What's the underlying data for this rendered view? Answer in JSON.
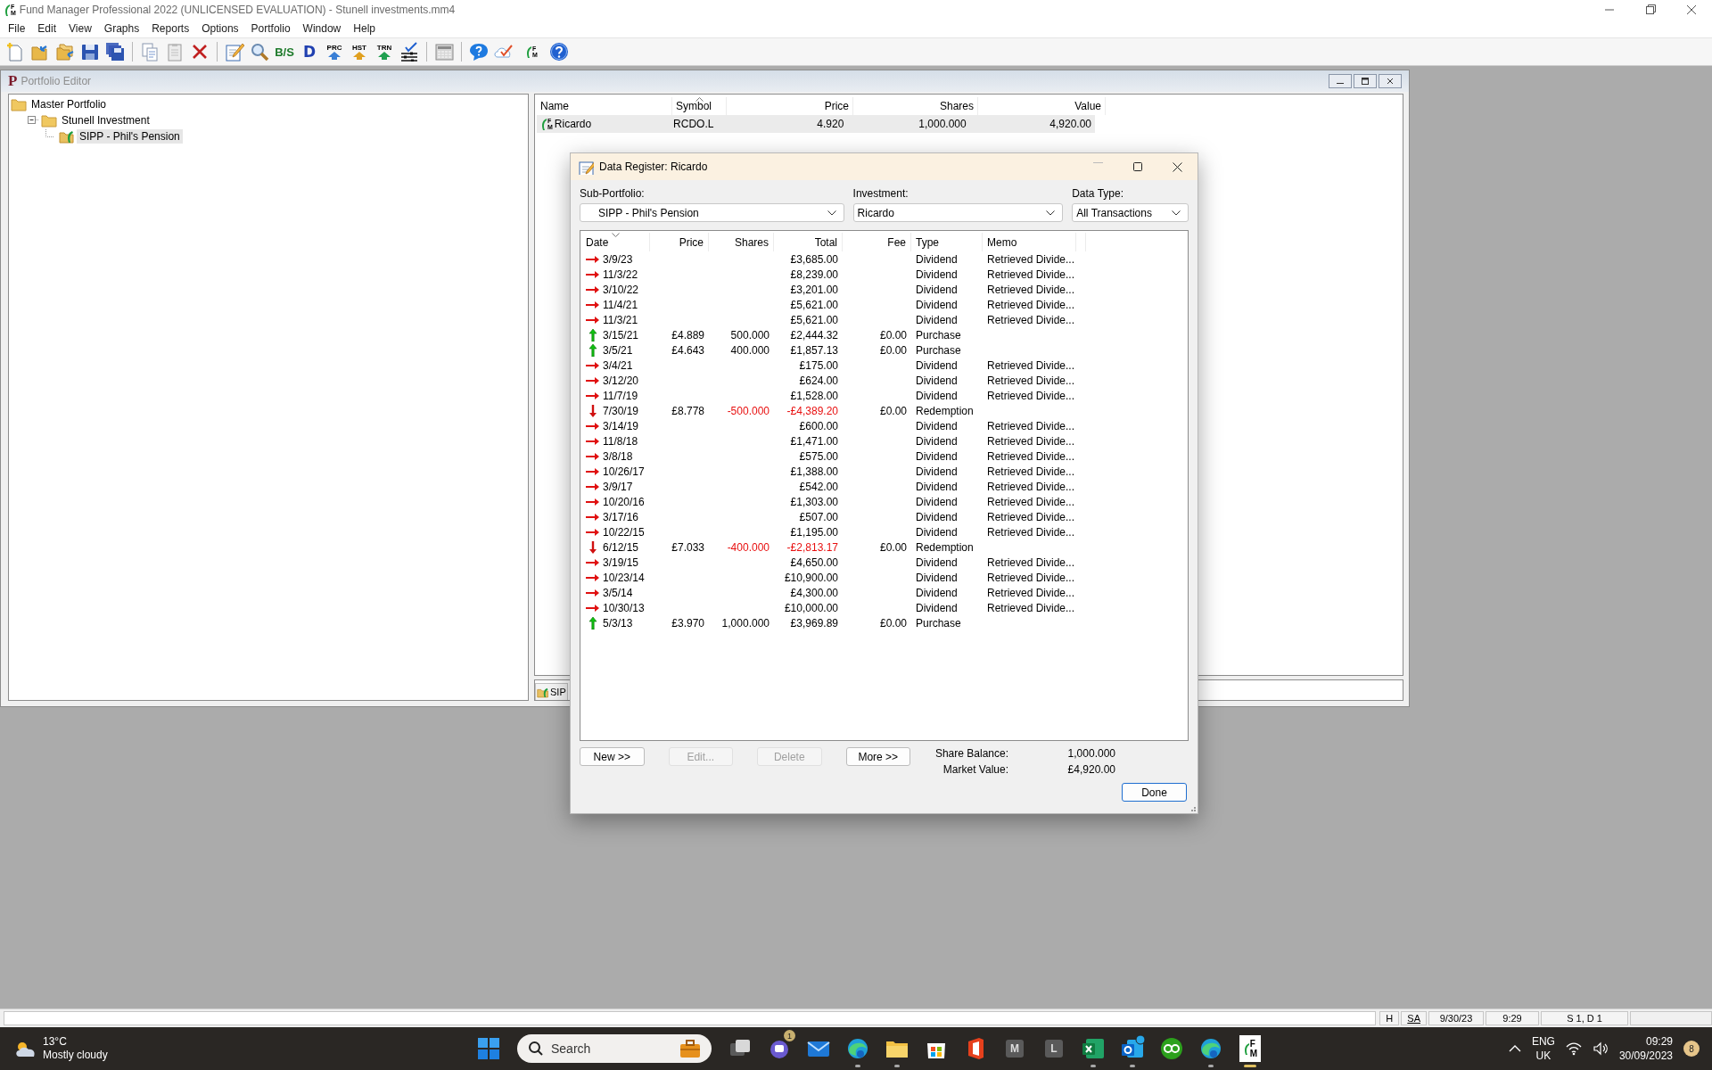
{
  "window": {
    "title": "Fund Manager Professional 2022 (UNLICENSED EVALUATION) - Stunell investments.mm4",
    "icon_letters": [
      "F",
      "M"
    ]
  },
  "menu": [
    "File",
    "Edit",
    "View",
    "Graphs",
    "Reports",
    "Options",
    "Portfolio",
    "Window",
    "Help"
  ],
  "toolbar": [
    {
      "kind": "new"
    },
    {
      "kind": "open"
    },
    {
      "kind": "open-copy"
    },
    {
      "kind": "save"
    },
    {
      "kind": "save-all"
    },
    {
      "kind": "sep"
    },
    {
      "kind": "copy"
    },
    {
      "kind": "paste"
    },
    {
      "kind": "delete"
    },
    {
      "kind": "sep"
    },
    {
      "kind": "edit"
    },
    {
      "kind": "find"
    },
    {
      "kind": "bs",
      "label": "B/S"
    },
    {
      "kind": "d",
      "label": "D"
    },
    {
      "kind": "arrow",
      "label": "PRC",
      "color": "#3a7fd5"
    },
    {
      "kind": "arrow",
      "label": "HST",
      "color": "#e0a020"
    },
    {
      "kind": "arrow",
      "label": "TRN",
      "color": "#20a050"
    },
    {
      "kind": "filter"
    },
    {
      "kind": "sep"
    },
    {
      "kind": "calc"
    },
    {
      "kind": "sep"
    },
    {
      "kind": "chat"
    },
    {
      "kind": "cloud"
    },
    {
      "kind": "fm",
      "letters": [
        "F",
        "M"
      ]
    },
    {
      "kind": "help"
    }
  ],
  "portfolio_editor": {
    "title": "Portfolio Editor",
    "icon_letter": "P",
    "tree": [
      {
        "label": "Master Portfolio",
        "kind": "folder",
        "selected": false,
        "children": [
          {
            "label": "Stunell Investment",
            "kind": "folder",
            "selected": false,
            "expanded": true,
            "children": [
              {
                "label": "SIPP - Phil's Pension",
                "kind": "subportfolio",
                "selected": true
              }
            ]
          }
        ]
      }
    ],
    "columns": [
      {
        "label": "Name",
        "sorted": false
      },
      {
        "label": "Symbol",
        "sorted": true,
        "sort_descending": false
      },
      {
        "label": "Price",
        "sorted": false
      },
      {
        "label": "Shares",
        "sorted": false
      },
      {
        "label": "Value",
        "sorted": false
      }
    ],
    "rows": [
      {
        "icon_letters": [
          "F",
          "M"
        ],
        "cells": [
          "Ricardo",
          "RCDO.L",
          "4.920",
          "1,000.000",
          "4,920.00"
        ],
        "selected": true
      }
    ],
    "tab": {
      "label": "SIP"
    }
  },
  "dialog": {
    "title": "Data Register: Ricardo",
    "filters": [
      {
        "label": "Sub-Portfolio:",
        "value": "SIPP - Phil's Pension"
      },
      {
        "label": "Investment:",
        "value": "Ricardo"
      },
      {
        "label": "Data Type:",
        "value": "All Transactions"
      }
    ],
    "columns": [
      {
        "label": "Date",
        "sorted": true,
        "sort_descending": true
      },
      {
        "label": "Price",
        "sorted": false
      },
      {
        "label": "Shares",
        "sorted": false
      },
      {
        "label": "Total",
        "sorted": false
      },
      {
        "label": "Fee",
        "sorted": false
      },
      {
        "label": "Type",
        "sorted": false
      },
      {
        "label": "Memo",
        "sorted": false
      }
    ],
    "rows": [
      {
        "kind": "dividend",
        "date": "3/9/23",
        "total": "£3,685.00",
        "type": "Dividend",
        "memo": "Retrieved Divide..."
      },
      {
        "kind": "dividend",
        "date": "11/3/22",
        "total": "£8,239.00",
        "type": "Dividend",
        "memo": "Retrieved Divide..."
      },
      {
        "kind": "dividend",
        "date": "3/10/22",
        "total": "£3,201.00",
        "type": "Dividend",
        "memo": "Retrieved Divide..."
      },
      {
        "kind": "dividend",
        "date": "11/4/21",
        "total": "£5,621.00",
        "type": "Dividend",
        "memo": "Retrieved Divide..."
      },
      {
        "kind": "dividend",
        "date": "11/3/21",
        "total": "£5,621.00",
        "type": "Dividend",
        "memo": "Retrieved Divide..."
      },
      {
        "kind": "purchase",
        "date": "3/15/21",
        "price": "£4.889",
        "shares": "500.000",
        "total": "£2,444.32",
        "fee": "£0.00",
        "type": "Purchase"
      },
      {
        "kind": "purchase",
        "date": "3/5/21",
        "price": "£4.643",
        "shares": "400.000",
        "total": "£1,857.13",
        "fee": "£0.00",
        "type": "Purchase"
      },
      {
        "kind": "dividend",
        "date": "3/4/21",
        "total": "£175.00",
        "type": "Dividend",
        "memo": "Retrieved Divide..."
      },
      {
        "kind": "dividend",
        "date": "3/12/20",
        "total": "£624.00",
        "type": "Dividend",
        "memo": "Retrieved Divide..."
      },
      {
        "kind": "dividend",
        "date": "11/7/19",
        "total": "£1,528.00",
        "type": "Dividend",
        "memo": "Retrieved Divide..."
      },
      {
        "kind": "redemption",
        "date": "7/30/19",
        "price": "£8.778",
        "shares": "-500.000",
        "total": "-£4,389.20",
        "fee": "£0.00",
        "type": "Redemption"
      },
      {
        "kind": "dividend",
        "date": "3/14/19",
        "total": "£600.00",
        "type": "Dividend",
        "memo": "Retrieved Divide..."
      },
      {
        "kind": "dividend",
        "date": "11/8/18",
        "total": "£1,471.00",
        "type": "Dividend",
        "memo": "Retrieved Divide..."
      },
      {
        "kind": "dividend",
        "date": "3/8/18",
        "total": "£575.00",
        "type": "Dividend",
        "memo": "Retrieved Divide..."
      },
      {
        "kind": "dividend",
        "date": "10/26/17",
        "total": "£1,388.00",
        "type": "Dividend",
        "memo": "Retrieved Divide..."
      },
      {
        "kind": "dividend",
        "date": "3/9/17",
        "total": "£542.00",
        "type": "Dividend",
        "memo": "Retrieved Divide..."
      },
      {
        "kind": "dividend",
        "date": "10/20/16",
        "total": "£1,303.00",
        "type": "Dividend",
        "memo": "Retrieved Divide..."
      },
      {
        "kind": "dividend",
        "date": "3/17/16",
        "total": "£507.00",
        "type": "Dividend",
        "memo": "Retrieved Divide..."
      },
      {
        "kind": "dividend",
        "date": "10/22/15",
        "total": "£1,195.00",
        "type": "Dividend",
        "memo": "Retrieved Divide..."
      },
      {
        "kind": "redemption",
        "date": "6/12/15",
        "price": "£7.033",
        "shares": "-400.000",
        "total": "-£2,813.17",
        "fee": "£0.00",
        "type": "Redemption"
      },
      {
        "kind": "dividend",
        "date": "3/19/15",
        "total": "£4,650.00",
        "type": "Dividend",
        "memo": "Retrieved Divide..."
      },
      {
        "kind": "dividend",
        "date": "10/23/14",
        "total": "£10,900.00",
        "type": "Dividend",
        "memo": "Retrieved Divide..."
      },
      {
        "kind": "dividend",
        "date": "3/5/14",
        "total": "£4,300.00",
        "type": "Dividend",
        "memo": "Retrieved Divide..."
      },
      {
        "kind": "dividend",
        "date": "10/30/13",
        "total": "£10,000.00",
        "type": "Dividend",
        "memo": "Retrieved Divide..."
      },
      {
        "kind": "purchase",
        "date": "5/3/13",
        "price": "£3.970",
        "shares": "1,000.000",
        "total": "£3,969.89",
        "fee": "£0.00",
        "type": "Purchase"
      }
    ],
    "buttons": [
      {
        "label": "New >>",
        "disabled": false
      },
      {
        "label": "Edit...",
        "disabled": true
      },
      {
        "label": "Delete",
        "disabled": true
      },
      {
        "label": "More >>",
        "disabled": false
      }
    ],
    "summary": [
      {
        "label": "Share Balance:",
        "value": "1,000.000"
      },
      {
        "label": "Market Value:",
        "value": "£4,920.00"
      }
    ],
    "done_button": {
      "label": "Done"
    }
  },
  "status_bar": [
    "H",
    "SA",
    "9/30/23",
    "9:29",
    "S 1, D 1"
  ],
  "taskbar": {
    "weather": {
      "temperature": "13°C",
      "condition": "Mostly cloudy"
    },
    "search": {
      "placeholder": "Search"
    },
    "apps": [
      {
        "kind": "start"
      },
      {
        "kind": "taskview",
        "running": false
      },
      {
        "kind": "chat",
        "running": false,
        "badge": "1"
      },
      {
        "kind": "mail",
        "running": false
      },
      {
        "kind": "edge",
        "running": true
      },
      {
        "kind": "explorer",
        "running": true
      },
      {
        "kind": "store",
        "running": false
      },
      {
        "kind": "office",
        "running": false
      },
      {
        "kind": "letter",
        "label": "M",
        "running": false
      },
      {
        "kind": "letter",
        "label": "L",
        "running": false
      },
      {
        "kind": "excel",
        "running": true
      },
      {
        "kind": "outlook",
        "running": true
      },
      {
        "kind": "quickbooks",
        "running": false
      },
      {
        "kind": "edge",
        "running": true
      },
      {
        "kind": "fm",
        "letters": [
          "F",
          "M"
        ],
        "running": true
      }
    ],
    "tray": {
      "language": "ENG",
      "region": "UK",
      "time": "09:29",
      "date": "30/09/2023",
      "badge": "8"
    }
  }
}
